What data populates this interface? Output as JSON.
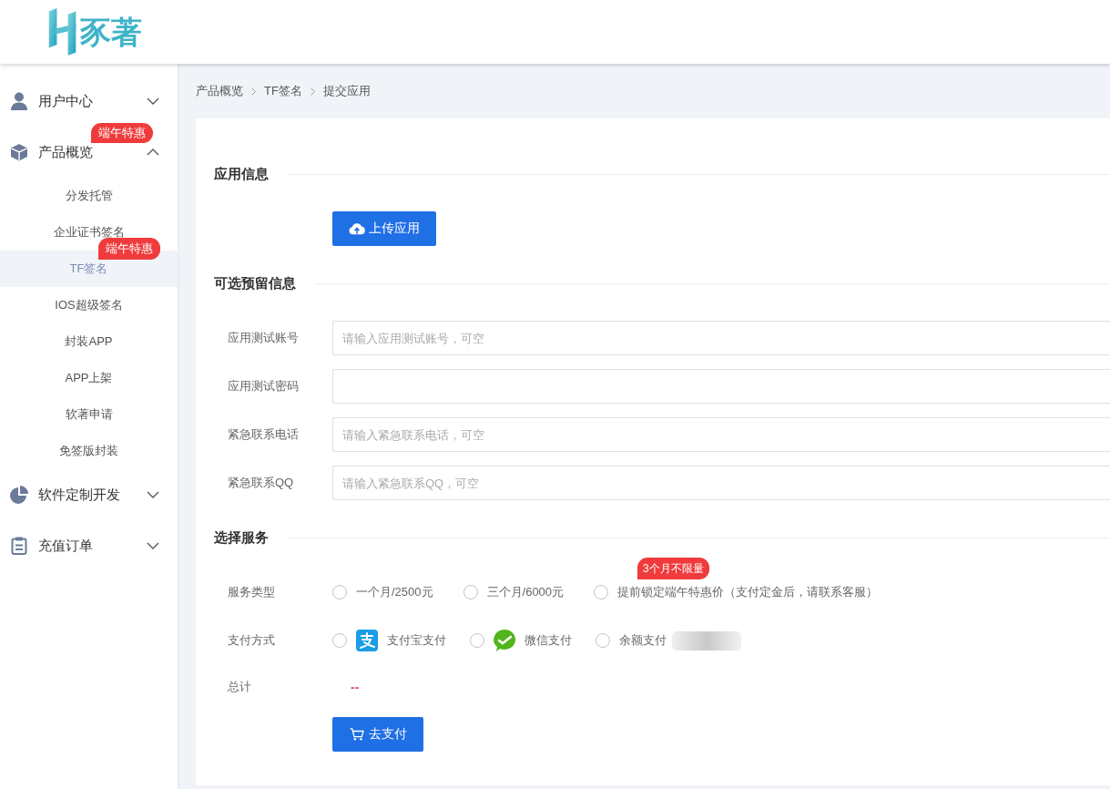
{
  "header": {
    "logo_text": "豕著"
  },
  "sidebar": {
    "items": [
      {
        "label": "用户中心",
        "kind": "user",
        "expanded": false
      },
      {
        "label": "产品概览",
        "kind": "cube",
        "expanded": true,
        "badge": "端午特惠",
        "children": [
          {
            "label": "分发托管",
            "selected": false
          },
          {
            "label": "企业证书签名",
            "selected": false
          },
          {
            "label": "TF签名",
            "selected": true,
            "badge": "端午特惠"
          },
          {
            "label": "IOS超级签名",
            "selected": false
          },
          {
            "label": "封装APP",
            "selected": false
          },
          {
            "label": "APP上架",
            "selected": false
          },
          {
            "label": "软著申请",
            "selected": false
          },
          {
            "label": "免签版封装",
            "selected": false
          }
        ]
      },
      {
        "label": "软件定制开发",
        "kind": "pie",
        "expanded": false
      },
      {
        "label": "充值订单",
        "kind": "clipboard",
        "expanded": false
      }
    ]
  },
  "breadcrumb": [
    "产品概览",
    "TF签名",
    "提交应用"
  ],
  "app_info": {
    "title": "应用信息",
    "upload_button": "上传应用"
  },
  "optional_info": {
    "title": "可选预留信息",
    "fields": [
      {
        "label": "应用测试账号",
        "placeholder": "请输入应用测试账号，可空"
      },
      {
        "label": "应用测试密码"
      },
      {
        "label": "紧急联系电话",
        "placeholder": "请输入紧急联系电话，可空"
      },
      {
        "label": "紧急联系QQ",
        "placeholder": "请输入紧急联系QQ，可空"
      }
    ]
  },
  "service": {
    "title": "选择服务",
    "service_type": {
      "label": "服务类型",
      "options": [
        {
          "label": "一个月/2500元",
          "selected": false
        },
        {
          "label": "三个月/6000元",
          "selected": false
        },
        {
          "label": "提前锁定端午特惠价（支付定金后，请联系客服）",
          "selected": false,
          "badge": "3个月不限量"
        }
      ]
    },
    "payment": {
      "label": "支付方式",
      "options": [
        {
          "label": "支付宝支付",
          "kind": "alipay",
          "selected": false
        },
        {
          "label": "微信支付",
          "kind": "wechat",
          "selected": false
        },
        {
          "label": "余额支付",
          "kind": "balance",
          "selected": false,
          "masked": true
        }
      ]
    },
    "total": {
      "label": "总计",
      "value": "--"
    },
    "pay_button": "去支付"
  }
}
